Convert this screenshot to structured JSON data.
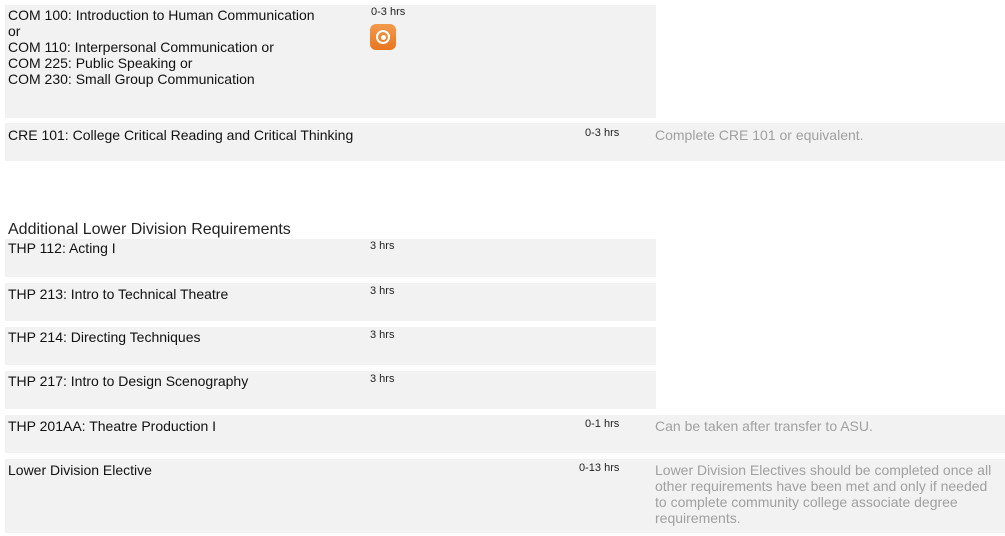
{
  "groups": [
    {
      "course": "COM 100: Introduction to Human Communication or\nCOM 110: Interpersonal Communication or\nCOM 225: Public Speaking or\nCOM 230: Small Group Communication",
      "hrs": "0-3 hrs",
      "icon": "pathway-badge-icon",
      "accent": "#ec7d27"
    },
    {
      "course": "CRE 101: College Critical Reading and Critical Thinking",
      "hrs": "0-3 hrs",
      "note": "Complete CRE 101 or equivalent."
    }
  ],
  "section_title": "Additional Lower Division Requirements",
  "requirements": [
    {
      "course": "THP 112: Acting I",
      "hrs": "3 hrs"
    },
    {
      "course": "THP 213: Intro to Technical Theatre",
      "hrs": "3 hrs"
    },
    {
      "course": "THP 214: Directing Techniques",
      "hrs": "3 hrs"
    },
    {
      "course": "THP 217: Intro to Design Scenography",
      "hrs": "3 hrs"
    },
    {
      "course": "THP 201AA: Theatre Production I",
      "hrs": "0-1 hrs",
      "note": "Can be taken after transfer to ASU."
    },
    {
      "course": "Lower Division Elective",
      "hrs": "0-13 hrs",
      "note": "Lower Division Electives should be completed once all other requirements have been met and only if needed to complete community college associate degree requirements."
    }
  ]
}
